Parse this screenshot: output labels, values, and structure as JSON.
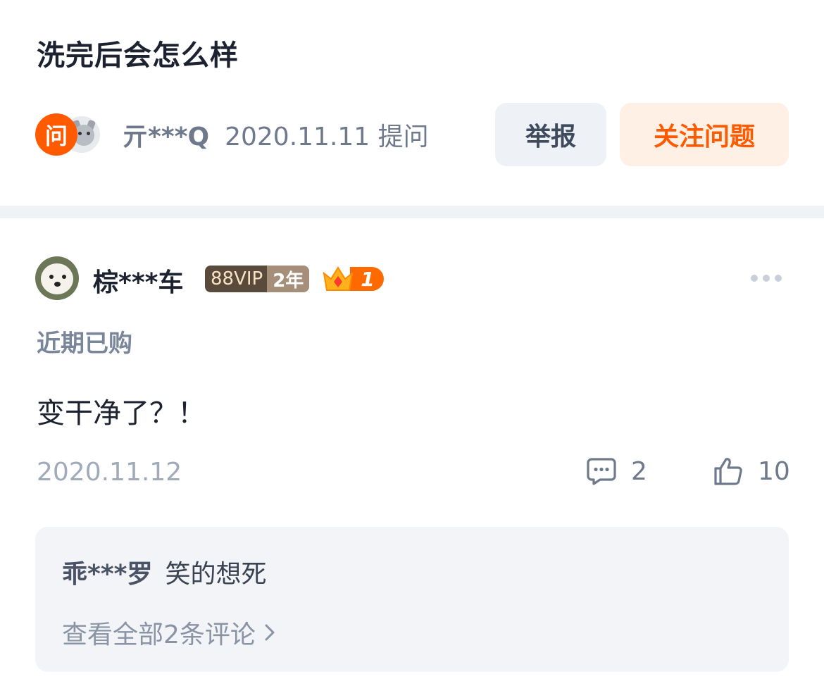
{
  "question": {
    "title": "洗完后会怎么样",
    "ask_badge": "问",
    "asker_name": "亓***Q",
    "asker_meta": "2020.11.11 提问",
    "report_label": "举报",
    "follow_label": "关注问题"
  },
  "answer": {
    "user_name": "棕***车",
    "vip_label": "88VIP",
    "vip_years": "2年",
    "level": "1",
    "tag": "近期已购",
    "text": "变干净了？！",
    "date": "2020.11.12",
    "comment_count": "2",
    "like_count": "10"
  },
  "reply": {
    "user": "乖***罗",
    "text": "笑的想死",
    "view_all": "查看全部2条评论"
  },
  "colors": {
    "accent": "#ff5a00",
    "follow_bg": "#fff0e5",
    "report_bg": "#eef2f6",
    "muted_text": "#6e7a8c",
    "reply_bg": "#f2f4f7"
  },
  "icons": [
    "ask-badge-icon",
    "comment-icon",
    "thumbs-up-icon",
    "crown-icon",
    "more-dots-icon",
    "chevron-right-icon"
  ]
}
